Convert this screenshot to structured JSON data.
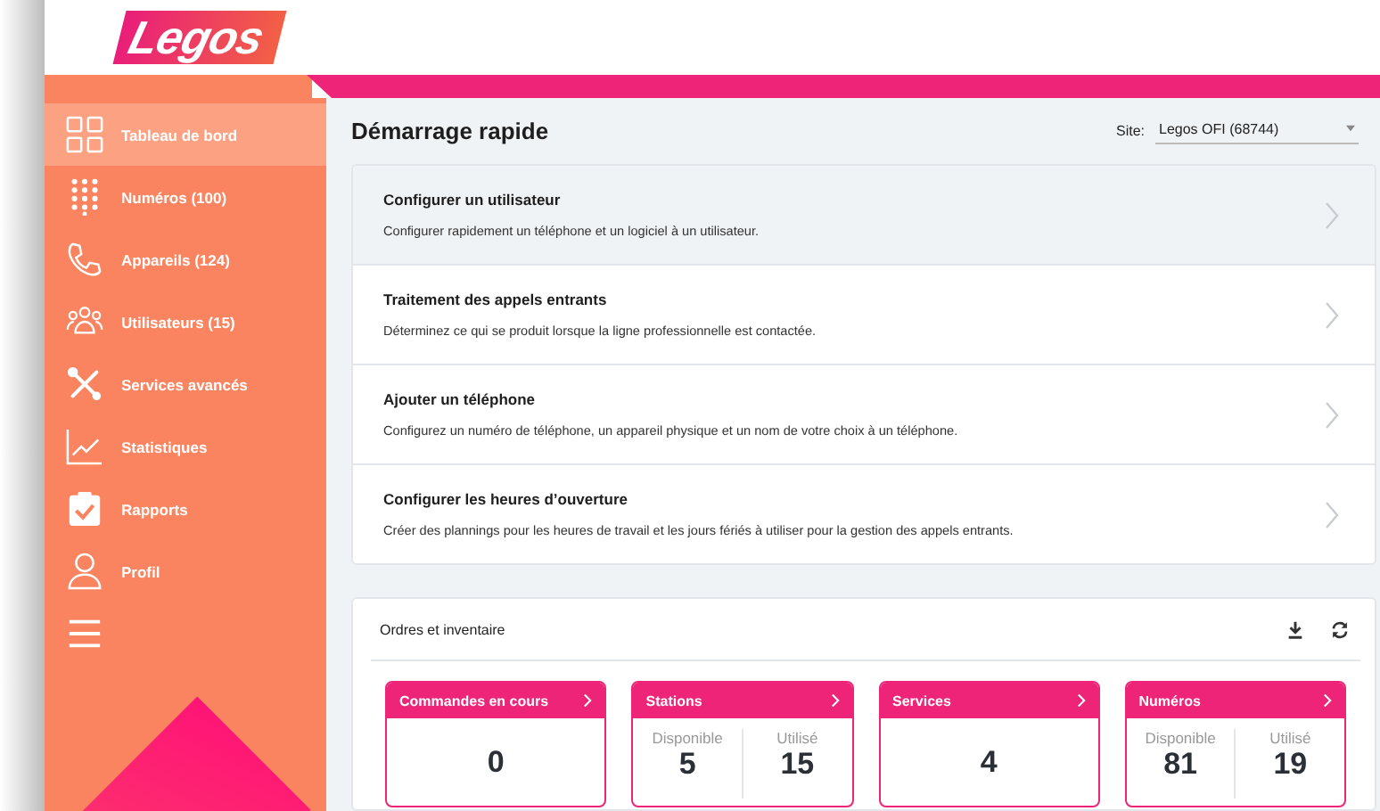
{
  "logo": {
    "text": "Legos"
  },
  "sidebar": {
    "items": [
      {
        "kind": "grid",
        "label": "Tableau de bord",
        "selected": true
      },
      {
        "kind": "keypad",
        "label": "Numéros (100)",
        "selected": false
      },
      {
        "kind": "phone",
        "label": "Appareils (124)",
        "selected": false
      },
      {
        "kind": "users",
        "label": "Utilisateurs (15)",
        "selected": false
      },
      {
        "kind": "tools",
        "label": "Services avancés",
        "selected": false
      },
      {
        "kind": "chart",
        "label": "Statistiques",
        "selected": false
      },
      {
        "kind": "clipboard",
        "label": "Rapports",
        "selected": false
      },
      {
        "kind": "user",
        "label": "Profil",
        "selected": false
      },
      {
        "kind": "menu",
        "selected": false
      }
    ]
  },
  "quick_start": {
    "title": "Démarrage rapide",
    "site_label": "Site:",
    "site_value": "Legos OFI (68744)",
    "items": [
      {
        "title": "Configurer un utilisateur",
        "description": "Configurer rapidement un téléphone et un logiciel à un utilisateur.",
        "highlighted": true
      },
      {
        "title": "Traitement des appels entrants",
        "description": "Déterminez ce qui se produit lorsque la ligne professionnelle est contactée.",
        "highlighted": false
      },
      {
        "title": "Ajouter un téléphone",
        "description": "Configurez un numéro de téléphone, un appareil physique et un nom de votre choix à un téléphone.",
        "highlighted": false
      },
      {
        "title": "Configurer les heures d’ouverture",
        "description": "Créer des plannings pour les heures de travail et les jours fériés à utiliser pour la gestion des appels entrants.",
        "highlighted": false
      }
    ]
  },
  "inventory": {
    "title": "Ordres et inventaire",
    "tiles": [
      {
        "kind": "single",
        "title": "Commandes en cours",
        "value": "0"
      },
      {
        "kind": "split",
        "title": "Stations",
        "left_label": "Disponible",
        "left_value": "5",
        "right_label": "Utilisé",
        "right_value": "15"
      },
      {
        "kind": "single",
        "title": "Services",
        "value": "4"
      },
      {
        "kind": "split",
        "title": "Numéros",
        "left_label": "Disponible",
        "left_value": "81",
        "right_label": "Utilisé",
        "right_value": "19"
      }
    ]
  }
}
